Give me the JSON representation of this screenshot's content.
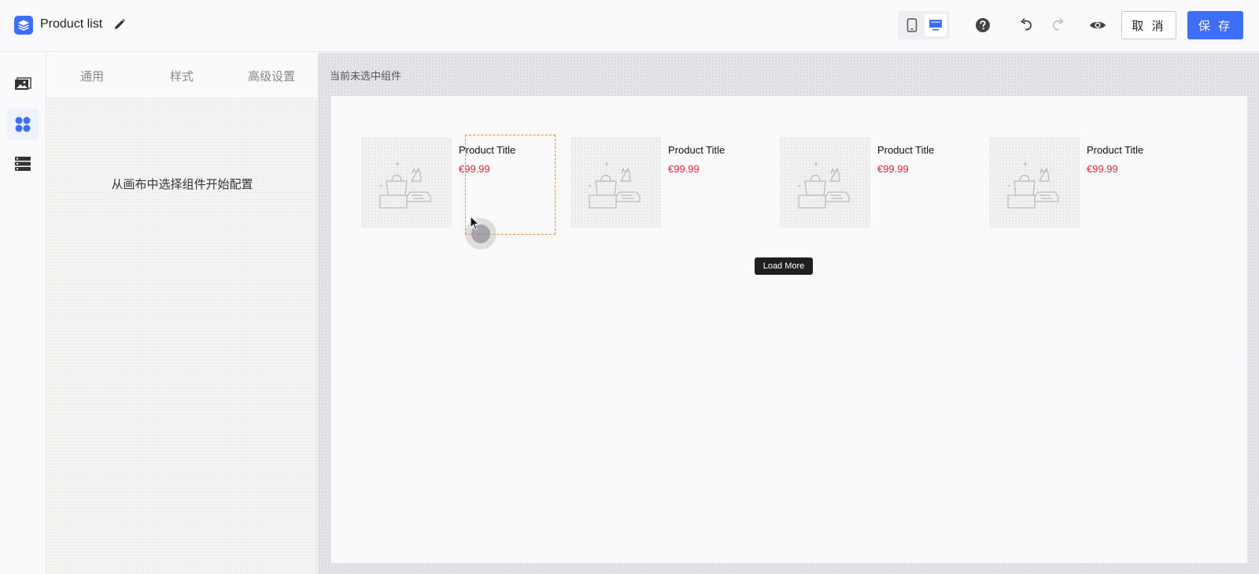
{
  "header": {
    "title": "Product list",
    "cancel_label": "取 消",
    "save_label": "保 存"
  },
  "settings_panel": {
    "tabs": [
      "通用",
      "样式",
      "高级设置"
    ],
    "hint": "从画布中选择组件开始配置"
  },
  "canvas": {
    "status": "当前未选中组件",
    "products": [
      {
        "title": "Product Title",
        "price": "€99.99"
      },
      {
        "title": "Product Title",
        "price": "€99.99"
      },
      {
        "title": "Product Title",
        "price": "€99.99"
      },
      {
        "title": "Product Title",
        "price": "€99.99"
      }
    ],
    "load_more_label": "Load More"
  },
  "colors": {
    "accent": "#3d6ef5",
    "price": "#e5242f",
    "hover_outline": "#f0911d"
  },
  "icons": [
    "layers-logo-icon",
    "pencil-icon",
    "mobile-icon",
    "desktop-icon",
    "help-icon",
    "undo-icon",
    "redo-icon",
    "eye-icon",
    "images-icon",
    "components-icon",
    "list-layers-icon",
    "shopping-items-icon",
    "cursor-arrow-icon"
  ]
}
